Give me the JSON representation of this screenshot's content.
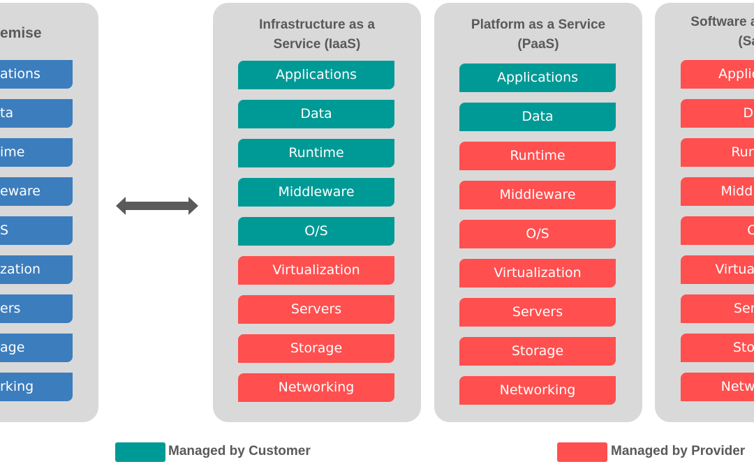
{
  "colors": {
    "customer": "#009a96",
    "provider": "#ff4f4f",
    "on_premise": "#3c7dbd",
    "panel_bg": "#d9d9d9",
    "title_text": "#595959",
    "arrow": "#5a5a5a"
  },
  "panels": [
    {
      "title": "On-premise",
      "title_visible": "emise",
      "items": [
        {
          "label": "Applications",
          "visible": "ations",
          "managed_by": "on_premise"
        },
        {
          "label": "Data",
          "visible": "ta",
          "managed_by": "on_premise"
        },
        {
          "label": "Runtime",
          "visible": "ime",
          "managed_by": "on_premise"
        },
        {
          "label": "Middleware",
          "visible": "eware",
          "managed_by": "on_premise"
        },
        {
          "label": "O/S",
          "visible": "S",
          "managed_by": "on_premise"
        },
        {
          "label": "Virtualization",
          "visible": "zation",
          "managed_by": "on_premise"
        },
        {
          "label": "Servers",
          "visible": "ers",
          "managed_by": "on_premise"
        },
        {
          "label": "Storage",
          "visible": "age",
          "managed_by": "on_premise"
        },
        {
          "label": "Networking",
          "visible": "rking",
          "managed_by": "on_premise"
        }
      ]
    },
    {
      "title_line1": "Infrastructure as a",
      "title_line2": "Service (IaaS)",
      "items": [
        {
          "label": "Applications",
          "managed_by": "customer"
        },
        {
          "label": "Data",
          "managed_by": "customer"
        },
        {
          "label": "Runtime",
          "managed_by": "customer"
        },
        {
          "label": "Middleware",
          "managed_by": "customer"
        },
        {
          "label": "O/S",
          "managed_by": "customer"
        },
        {
          "label": "Virtualization",
          "managed_by": "provider"
        },
        {
          "label": "Servers",
          "managed_by": "provider"
        },
        {
          "label": "Storage",
          "managed_by": "provider"
        },
        {
          "label": "Networking",
          "managed_by": "provider"
        }
      ]
    },
    {
      "title_line1": "Platform as a Service",
      "title_line2": "(PaaS)",
      "items": [
        {
          "label": "Applications",
          "managed_by": "customer"
        },
        {
          "label": "Data",
          "managed_by": "customer"
        },
        {
          "label": "Runtime",
          "managed_by": "provider"
        },
        {
          "label": "Middleware",
          "managed_by": "provider"
        },
        {
          "label": "O/S",
          "managed_by": "provider"
        },
        {
          "label": "Virtualization",
          "managed_by": "provider"
        },
        {
          "label": "Servers",
          "managed_by": "provider"
        },
        {
          "label": "Storage",
          "managed_by": "provider"
        },
        {
          "label": "Networking",
          "managed_by": "provider"
        }
      ]
    },
    {
      "title_line1": "Software as a Service",
      "title_line2": "(SaaS)",
      "items": [
        {
          "label": "Applications",
          "managed_by": "provider"
        },
        {
          "label": "Data",
          "managed_by": "provider"
        },
        {
          "label": "Runtime",
          "managed_by": "provider"
        },
        {
          "label": "Middleware",
          "managed_by": "provider"
        },
        {
          "label": "O/S",
          "managed_by": "provider"
        },
        {
          "label": "Virtualization",
          "managed_by": "provider"
        },
        {
          "label": "Servers",
          "managed_by": "provider"
        },
        {
          "label": "Storage",
          "managed_by": "provider"
        },
        {
          "label": "Networking",
          "managed_by": "provider"
        }
      ]
    }
  ],
  "legend": {
    "customer_label": "Managed by Customer",
    "provider_label": "Managed by Provider"
  },
  "arrow": {
    "icon": "double-arrow-icon"
  }
}
